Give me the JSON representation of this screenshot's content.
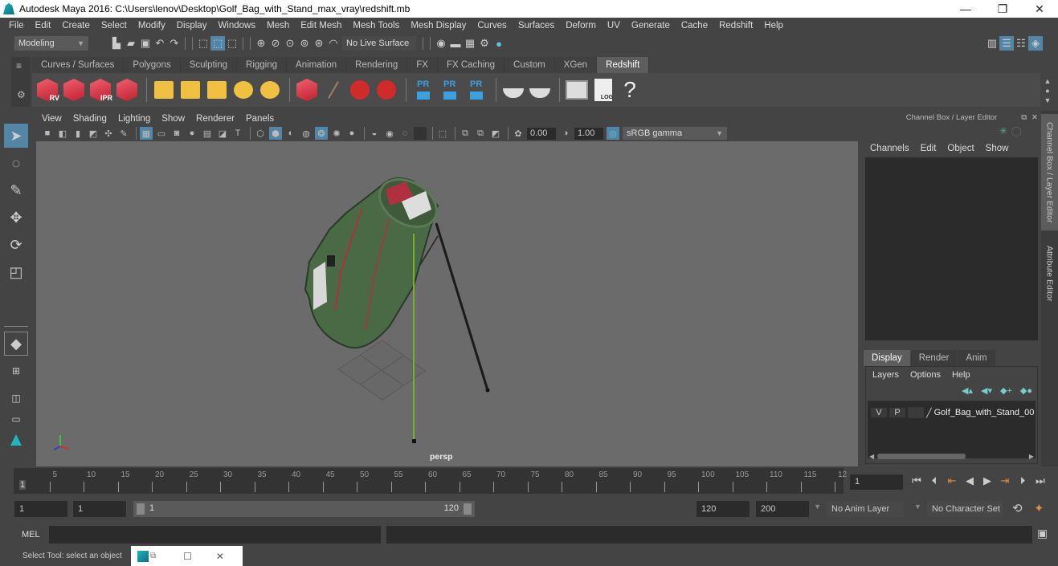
{
  "window": {
    "title": "Autodesk Maya 2016: C:\\Users\\lenov\\Desktop\\Golf_Bag_with_Stand_max_vray\\redshift.mb",
    "minimize_label": "—",
    "maximize_label": "❐",
    "close_label": "✕"
  },
  "menubar": [
    "File",
    "Edit",
    "Create",
    "Select",
    "Modify",
    "Display",
    "Windows",
    "Mesh",
    "Edit Mesh",
    "Mesh Tools",
    "Mesh Display",
    "Curves",
    "Surfaces",
    "Deform",
    "UV",
    "Generate",
    "Cache",
    "Redshift",
    "Help"
  ],
  "statusline": {
    "menuset": "Modeling",
    "live_surface": "No Live Surface"
  },
  "shelf": {
    "tabs": [
      "Curves / Surfaces",
      "Polygons",
      "Sculpting",
      "Rigging",
      "Animation",
      "Rendering",
      "FX",
      "FX Caching",
      "Custom",
      "XGen",
      "Redshift"
    ],
    "active_tab": "Redshift",
    "icons": [
      {
        "name": "redshift-render-view-icon",
        "label": "RV"
      },
      {
        "name": "redshift-batch-render-icon",
        "label": ""
      },
      {
        "name": "redshift-ipr-icon",
        "label": "IPR"
      },
      {
        "name": "redshift-render-settings-icon",
        "label": ""
      },
      {
        "name": "redshift-light-icon",
        "label": ""
      },
      {
        "name": "redshift-portal-light-icon",
        "label": ""
      },
      {
        "name": "redshift-ies-light-icon",
        "label": ""
      },
      {
        "name": "redshift-dome-light-icon",
        "label": ""
      },
      {
        "name": "redshift-sun-sky-icon",
        "label": ""
      },
      {
        "name": "redshift-proxy-icon",
        "label": ""
      },
      {
        "name": "redshift-hair-icon",
        "label": ""
      },
      {
        "name": "redshift-volume-icon",
        "label": ""
      },
      {
        "name": "redshift-sphere-icon",
        "label": ""
      },
      {
        "name": "pr-object-icon",
        "label": "PR"
      },
      {
        "name": "pr-export-icon",
        "label": "PR"
      },
      {
        "name": "pr-transfer-icon",
        "label": "PR"
      },
      {
        "name": "cake-icon",
        "label": ""
      },
      {
        "name": "cake-single-icon",
        "label": ""
      },
      {
        "name": "script-editor-icon",
        "label": ""
      },
      {
        "name": "log-icon",
        "label": "LOG"
      },
      {
        "name": "help-icon",
        "label": "?"
      }
    ]
  },
  "panel": {
    "menu": [
      "View",
      "Shading",
      "Lighting",
      "Show",
      "Renderer",
      "Panels"
    ],
    "exposure": "0.00",
    "gamma": "1.00",
    "color_space": "sRGB gamma",
    "camera_label": "persp"
  },
  "channel_box": {
    "title": "Channel Box / Layer Editor",
    "menu": [
      "Channels",
      "Edit",
      "Object",
      "Show"
    ]
  },
  "layer_editor": {
    "tabs": [
      "Display",
      "Render",
      "Anim"
    ],
    "active_tab": "Display",
    "menu": [
      "Layers",
      "Options",
      "Help"
    ],
    "layers": [
      {
        "v": "V",
        "p": "P",
        "name": "Golf_Bag_with_Stand_00"
      }
    ]
  },
  "side_tabs": [
    "Channel Box / Layer Editor",
    "Attribute Editor"
  ],
  "timeline": {
    "ticks": [
      "5",
      "10",
      "15",
      "20",
      "25",
      "30",
      "35",
      "40",
      "45",
      "50",
      "55",
      "60",
      "65",
      "70",
      "75",
      "80",
      "85",
      "90",
      "95",
      "100",
      "105",
      "110",
      "115",
      "12"
    ],
    "start_marker": "1",
    "current_frame": "1"
  },
  "range": {
    "start": "1",
    "playback_start": "1",
    "slider_min": "1",
    "slider_max": "120",
    "playback_end": "120",
    "end": "200",
    "anim_layer": "No Anim Layer",
    "character_set": "No Character Set"
  },
  "cmdline": {
    "label": "MEL"
  },
  "helpline": {
    "text": "Select Tool: select an object"
  }
}
